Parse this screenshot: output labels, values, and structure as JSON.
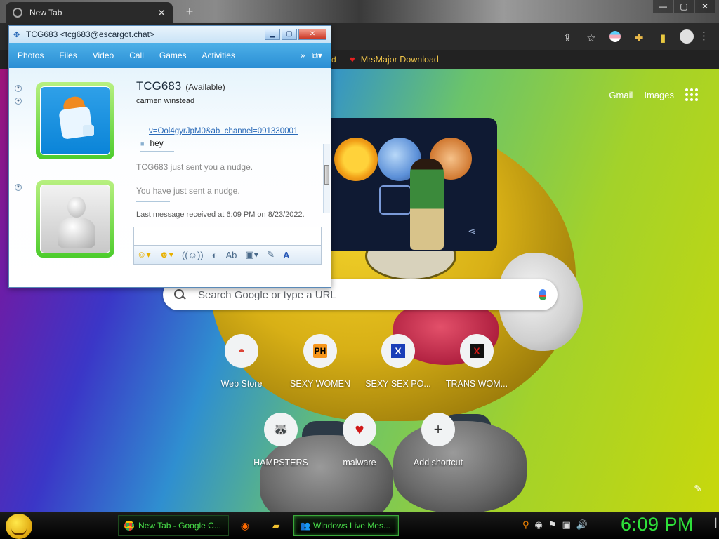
{
  "browser": {
    "tab_title": "New Tab",
    "tab_close": "✕",
    "new_tab": "+",
    "window_controls": [
      "—",
      "▢",
      "✕"
    ],
    "bookmark_fragment": "d",
    "bookmark_label": "MrsMajor Download"
  },
  "ntp": {
    "links": [
      "Gmail",
      "Images"
    ],
    "search_placeholder": "Search Google or type a URL",
    "shortcuts": [
      {
        "label": "Web Store",
        "icon": "◓",
        "color": "#db4437"
      },
      {
        "label": "SEXY WOMEN",
        "icon": "PH",
        "color": "#f7971d"
      },
      {
        "label": "SEXY SEX PO...",
        "icon": "X",
        "color": "#1a3eb8"
      },
      {
        "label": "TRANS WOM...",
        "icon": "X",
        "color": "#d01818"
      },
      {
        "label": "HAMPSTERS",
        "icon": "🦝",
        "color": "#333333"
      },
      {
        "label": "malware",
        "icon": "♥",
        "color": "#d01818"
      },
      {
        "label": "Add shortcut",
        "icon": "+",
        "color": "#333333"
      }
    ]
  },
  "wlm": {
    "title": "TCG683 <tcg683@escargot.chat>",
    "menu": [
      "Photos",
      "Files",
      "Video",
      "Call",
      "Games",
      "Activities"
    ],
    "menu_more": "»",
    "contact_name": "TCG683",
    "contact_status": "(Available)",
    "contact_sub": "carmen winstead",
    "messages": {
      "link": "v=Ool4gyrJpM0&ab_channel=091330001",
      "hey": "hey",
      "nudge_received": "TCG683 just sent you a nudge.",
      "nudge_sent": "You have just sent a nudge."
    },
    "last_message": "Last message received at 6:09 PM on 8/23/2022."
  },
  "taskbar": {
    "chrome_task": "New Tab - Google C...",
    "wlm_task": "Windows Live Mes...",
    "clock": "6:09 PM"
  }
}
